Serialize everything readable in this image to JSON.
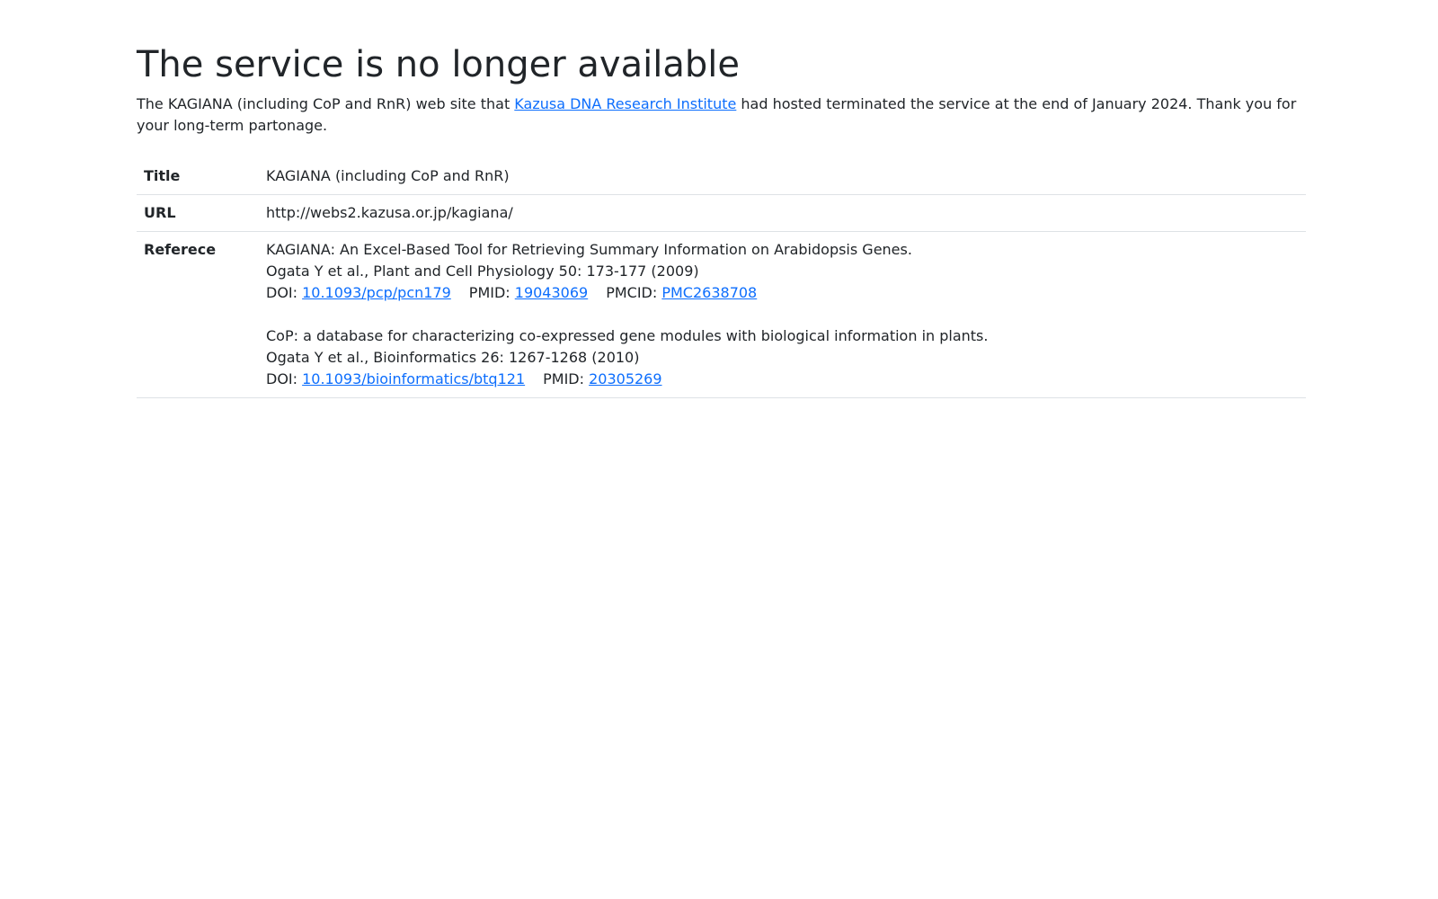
{
  "heading": "The service is no longer available",
  "intro": {
    "before": "The KAGIANA (including CoP and RnR) web site that ",
    "link_text": "Kazusa DNA Research Institute",
    "after": " had hosted terminated the service at the end of January 2024. Thank you for your long-term partonage."
  },
  "table": {
    "title_label": "Title",
    "title_value": "KAGIANA (including CoP and RnR)",
    "url_label": "URL",
    "url_value": "http://webs2.kazusa.or.jp/kagiana/",
    "ref_label": "Referece",
    "refs": [
      {
        "title": "KAGIANA: An Excel-Based Tool for Retrieving Summary Information on Arabidopsis Genes.",
        "citation": "Ogata Y et al., Plant and Cell Physiology 50: 173-177 (2009)",
        "doi_label": "DOI: ",
        "doi": "10.1093/pcp/pcn179",
        "pmid_label": "PMID: ",
        "pmid": "19043069",
        "pmcid_label": "PMCID: ",
        "pmcid": "PMC2638708"
      },
      {
        "title": "CoP: a database for characterizing co-expressed gene modules with biological information in plants.",
        "citation": "Ogata Y et al., Bioinformatics 26: 1267-1268 (2010)",
        "doi_label": "DOI: ",
        "doi": "10.1093/bioinformatics/btq121",
        "pmid_label": "PMID: ",
        "pmid": "20305269"
      }
    ]
  }
}
